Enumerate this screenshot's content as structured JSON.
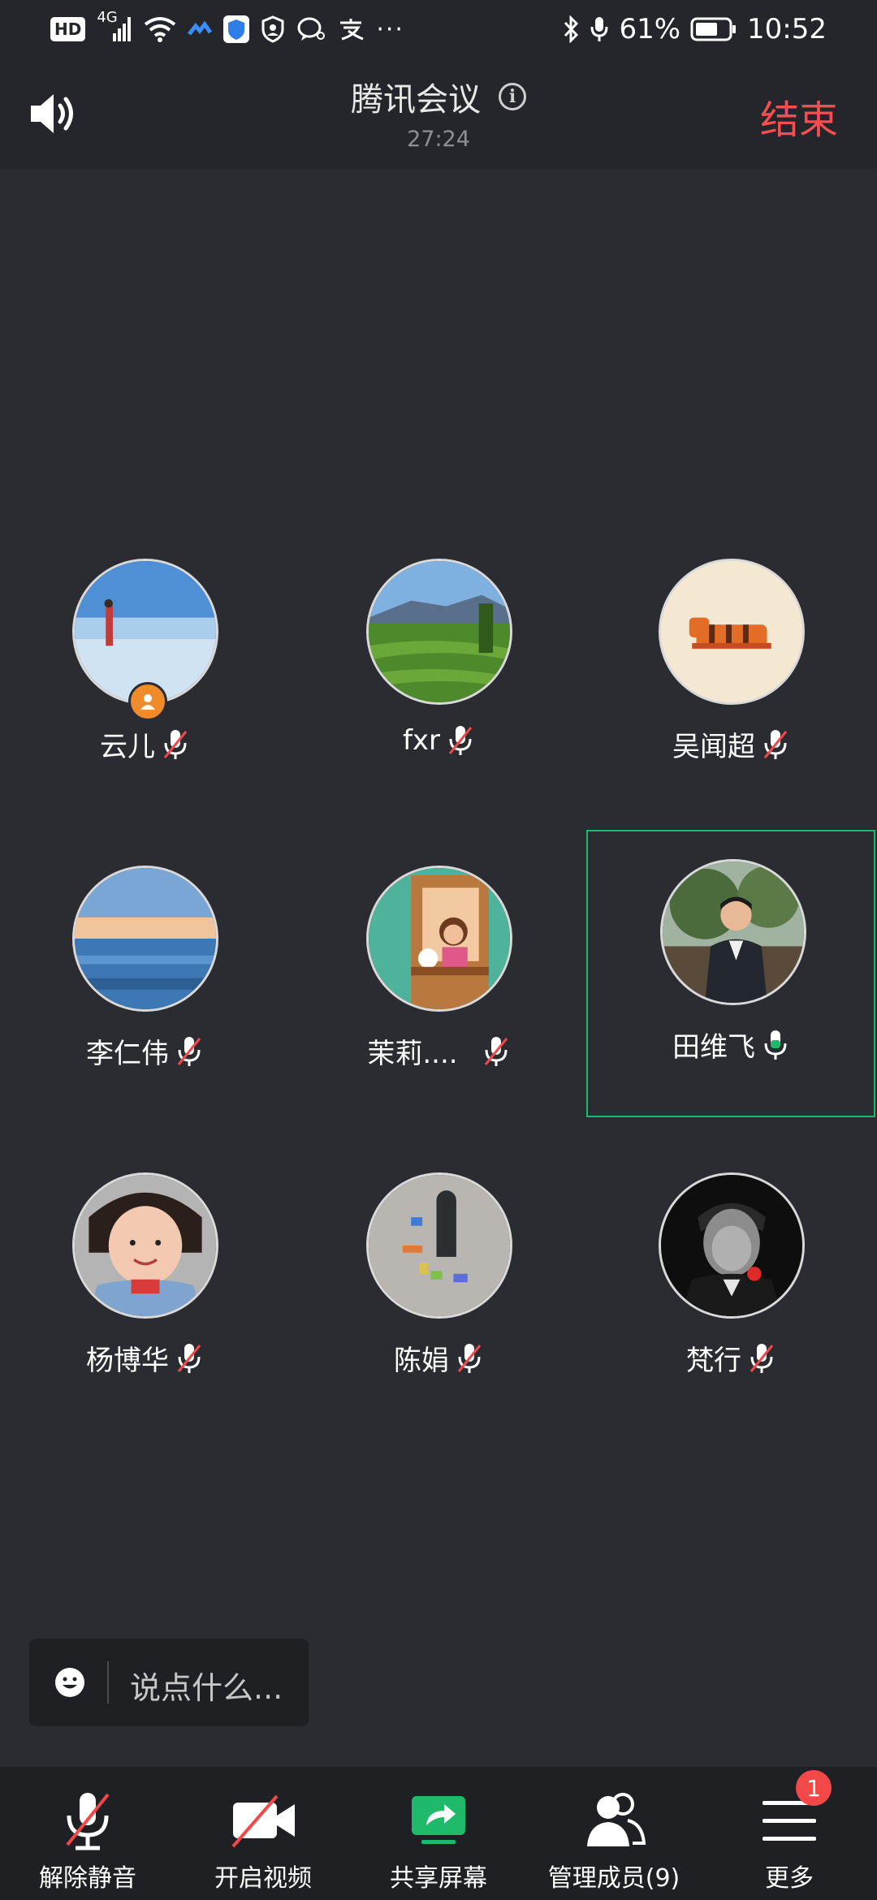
{
  "status_bar": {
    "hd": "HD",
    "network": "4G",
    "battery_text": "61%",
    "time": "10:52",
    "overflow": "···"
  },
  "header": {
    "title": "腾讯会议",
    "timer": "27:24",
    "end_label": "结束"
  },
  "participants": [
    {
      "name": "云儿",
      "mic": "muted",
      "host": true
    },
    {
      "name": "fxr",
      "mic": "muted",
      "host": false
    },
    {
      "name": "吴闻超",
      "mic": "muted",
      "host": false
    },
    {
      "name": "李仁伟",
      "mic": "muted",
      "host": false
    },
    {
      "name": "茉莉....",
      "mic": "muted",
      "host": false
    },
    {
      "name": "田维飞",
      "mic": "active",
      "host": false
    },
    {
      "name": "杨博华",
      "mic": "muted",
      "host": false
    },
    {
      "name": "陈娟",
      "mic": "muted",
      "host": false
    },
    {
      "name": "梵行",
      "mic": "muted",
      "host": false
    }
  ],
  "chat": {
    "placeholder": "说点什么..."
  },
  "toolbar": {
    "unmute_label": "解除静音",
    "video_label": "开启视频",
    "share_label": "共享屏幕",
    "members_label": "管理成员(9)",
    "more_label": "更多",
    "more_badge": "1"
  },
  "colors": {
    "accent_green": "#1fb96a",
    "end_red": "#f25050",
    "mute_red": "#f24848"
  }
}
